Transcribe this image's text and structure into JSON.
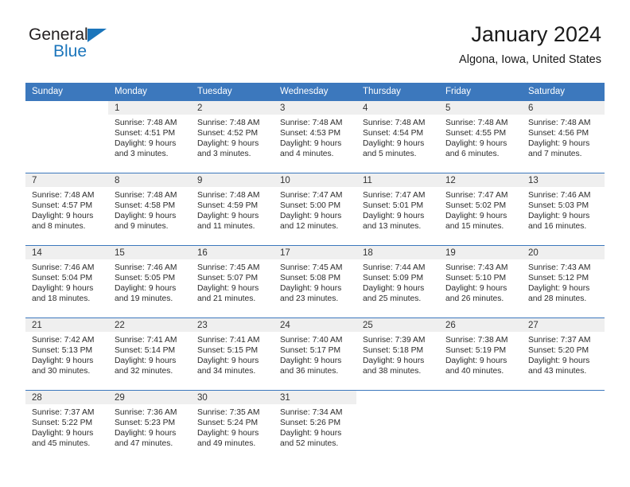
{
  "brand": {
    "name_part1": "General",
    "name_part2": "Blue",
    "logo_icon": "triangle-icon",
    "accent_color": "#1b75bb"
  },
  "header": {
    "title": "January 2024",
    "subtitle": "Algona, Iowa, United States"
  },
  "theme": {
    "header_blue": "#3c78bd",
    "band_gray": "#efefef"
  },
  "calendar": {
    "weekday_headers": [
      "Sunday",
      "Monday",
      "Tuesday",
      "Wednesday",
      "Thursday",
      "Friday",
      "Saturday"
    ],
    "weeks": [
      [
        {
          "day": "",
          "sunrise": "",
          "sunset": "",
          "daylight1": "",
          "daylight2": "",
          "blank": true
        },
        {
          "day": "1",
          "sunrise": "Sunrise: 7:48 AM",
          "sunset": "Sunset: 4:51 PM",
          "daylight1": "Daylight: 9 hours",
          "daylight2": "and 3 minutes."
        },
        {
          "day": "2",
          "sunrise": "Sunrise: 7:48 AM",
          "sunset": "Sunset: 4:52 PM",
          "daylight1": "Daylight: 9 hours",
          "daylight2": "and 3 minutes."
        },
        {
          "day": "3",
          "sunrise": "Sunrise: 7:48 AM",
          "sunset": "Sunset: 4:53 PM",
          "daylight1": "Daylight: 9 hours",
          "daylight2": "and 4 minutes."
        },
        {
          "day": "4",
          "sunrise": "Sunrise: 7:48 AM",
          "sunset": "Sunset: 4:54 PM",
          "daylight1": "Daylight: 9 hours",
          "daylight2": "and 5 minutes."
        },
        {
          "day": "5",
          "sunrise": "Sunrise: 7:48 AM",
          "sunset": "Sunset: 4:55 PM",
          "daylight1": "Daylight: 9 hours",
          "daylight2": "and 6 minutes."
        },
        {
          "day": "6",
          "sunrise": "Sunrise: 7:48 AM",
          "sunset": "Sunset: 4:56 PM",
          "daylight1": "Daylight: 9 hours",
          "daylight2": "and 7 minutes."
        }
      ],
      [
        {
          "day": "7",
          "sunrise": "Sunrise: 7:48 AM",
          "sunset": "Sunset: 4:57 PM",
          "daylight1": "Daylight: 9 hours",
          "daylight2": "and 8 minutes."
        },
        {
          "day": "8",
          "sunrise": "Sunrise: 7:48 AM",
          "sunset": "Sunset: 4:58 PM",
          "daylight1": "Daylight: 9 hours",
          "daylight2": "and 9 minutes."
        },
        {
          "day": "9",
          "sunrise": "Sunrise: 7:48 AM",
          "sunset": "Sunset: 4:59 PM",
          "daylight1": "Daylight: 9 hours",
          "daylight2": "and 11 minutes."
        },
        {
          "day": "10",
          "sunrise": "Sunrise: 7:47 AM",
          "sunset": "Sunset: 5:00 PM",
          "daylight1": "Daylight: 9 hours",
          "daylight2": "and 12 minutes."
        },
        {
          "day": "11",
          "sunrise": "Sunrise: 7:47 AM",
          "sunset": "Sunset: 5:01 PM",
          "daylight1": "Daylight: 9 hours",
          "daylight2": "and 13 minutes."
        },
        {
          "day": "12",
          "sunrise": "Sunrise: 7:47 AM",
          "sunset": "Sunset: 5:02 PM",
          "daylight1": "Daylight: 9 hours",
          "daylight2": "and 15 minutes."
        },
        {
          "day": "13",
          "sunrise": "Sunrise: 7:46 AM",
          "sunset": "Sunset: 5:03 PM",
          "daylight1": "Daylight: 9 hours",
          "daylight2": "and 16 minutes."
        }
      ],
      [
        {
          "day": "14",
          "sunrise": "Sunrise: 7:46 AM",
          "sunset": "Sunset: 5:04 PM",
          "daylight1": "Daylight: 9 hours",
          "daylight2": "and 18 minutes."
        },
        {
          "day": "15",
          "sunrise": "Sunrise: 7:46 AM",
          "sunset": "Sunset: 5:05 PM",
          "daylight1": "Daylight: 9 hours",
          "daylight2": "and 19 minutes."
        },
        {
          "day": "16",
          "sunrise": "Sunrise: 7:45 AM",
          "sunset": "Sunset: 5:07 PM",
          "daylight1": "Daylight: 9 hours",
          "daylight2": "and 21 minutes."
        },
        {
          "day": "17",
          "sunrise": "Sunrise: 7:45 AM",
          "sunset": "Sunset: 5:08 PM",
          "daylight1": "Daylight: 9 hours",
          "daylight2": "and 23 minutes."
        },
        {
          "day": "18",
          "sunrise": "Sunrise: 7:44 AM",
          "sunset": "Sunset: 5:09 PM",
          "daylight1": "Daylight: 9 hours",
          "daylight2": "and 25 minutes."
        },
        {
          "day": "19",
          "sunrise": "Sunrise: 7:43 AM",
          "sunset": "Sunset: 5:10 PM",
          "daylight1": "Daylight: 9 hours",
          "daylight2": "and 26 minutes."
        },
        {
          "day": "20",
          "sunrise": "Sunrise: 7:43 AM",
          "sunset": "Sunset: 5:12 PM",
          "daylight1": "Daylight: 9 hours",
          "daylight2": "and 28 minutes."
        }
      ],
      [
        {
          "day": "21",
          "sunrise": "Sunrise: 7:42 AM",
          "sunset": "Sunset: 5:13 PM",
          "daylight1": "Daylight: 9 hours",
          "daylight2": "and 30 minutes."
        },
        {
          "day": "22",
          "sunrise": "Sunrise: 7:41 AM",
          "sunset": "Sunset: 5:14 PM",
          "daylight1": "Daylight: 9 hours",
          "daylight2": "and 32 minutes."
        },
        {
          "day": "23",
          "sunrise": "Sunrise: 7:41 AM",
          "sunset": "Sunset: 5:15 PM",
          "daylight1": "Daylight: 9 hours",
          "daylight2": "and 34 minutes."
        },
        {
          "day": "24",
          "sunrise": "Sunrise: 7:40 AM",
          "sunset": "Sunset: 5:17 PM",
          "daylight1": "Daylight: 9 hours",
          "daylight2": "and 36 minutes."
        },
        {
          "day": "25",
          "sunrise": "Sunrise: 7:39 AM",
          "sunset": "Sunset: 5:18 PM",
          "daylight1": "Daylight: 9 hours",
          "daylight2": "and 38 minutes."
        },
        {
          "day": "26",
          "sunrise": "Sunrise: 7:38 AM",
          "sunset": "Sunset: 5:19 PM",
          "daylight1": "Daylight: 9 hours",
          "daylight2": "and 40 minutes."
        },
        {
          "day": "27",
          "sunrise": "Sunrise: 7:37 AM",
          "sunset": "Sunset: 5:20 PM",
          "daylight1": "Daylight: 9 hours",
          "daylight2": "and 43 minutes."
        }
      ],
      [
        {
          "day": "28",
          "sunrise": "Sunrise: 7:37 AM",
          "sunset": "Sunset: 5:22 PM",
          "daylight1": "Daylight: 9 hours",
          "daylight2": "and 45 minutes."
        },
        {
          "day": "29",
          "sunrise": "Sunrise: 7:36 AM",
          "sunset": "Sunset: 5:23 PM",
          "daylight1": "Daylight: 9 hours",
          "daylight2": "and 47 minutes."
        },
        {
          "day": "30",
          "sunrise": "Sunrise: 7:35 AM",
          "sunset": "Sunset: 5:24 PM",
          "daylight1": "Daylight: 9 hours",
          "daylight2": "and 49 minutes."
        },
        {
          "day": "31",
          "sunrise": "Sunrise: 7:34 AM",
          "sunset": "Sunset: 5:26 PM",
          "daylight1": "Daylight: 9 hours",
          "daylight2": "and 52 minutes."
        },
        {
          "day": "",
          "sunrise": "",
          "sunset": "",
          "daylight1": "",
          "daylight2": "",
          "blank": true
        },
        {
          "day": "",
          "sunrise": "",
          "sunset": "",
          "daylight1": "",
          "daylight2": "",
          "blank": true
        },
        {
          "day": "",
          "sunrise": "",
          "sunset": "",
          "daylight1": "",
          "daylight2": "",
          "blank": true
        }
      ]
    ]
  }
}
